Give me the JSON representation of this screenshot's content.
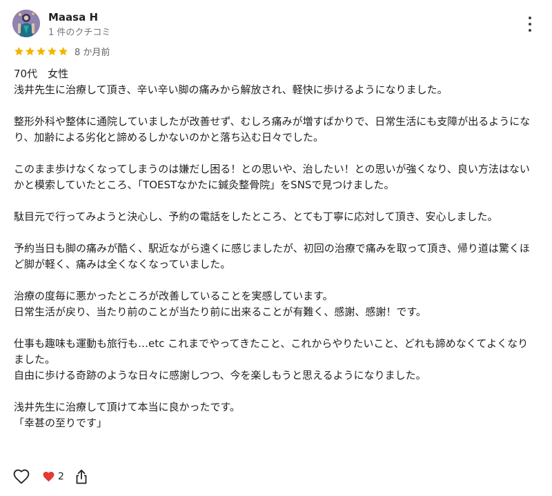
{
  "reviewer": {
    "name": "Maasa H",
    "review_count": "1 件のクチコミ",
    "avatar_icon": "avatar-illustration"
  },
  "rating": {
    "stars": 5,
    "max": 5,
    "star_color": "#f4b400",
    "date": "8 か月前"
  },
  "review": {
    "paragraphs": [
      "70代　女性\n浅井先生に治療して頂き、辛い辛い脚の痛みから解放され、軽快に歩けるようになりました。",
      "整形外科や整体に通院していましたが改善せず、むしろ痛みが増すばかりで、日常生活にも支障が出るようになり、加齢による劣化と諦めるしかないのかと落ち込む日々でした。",
      "このまま歩けなくなってしまうのは嫌だし困る！との思いや、治したい！との思いが強くなり、良い方法はないかと模索していたところ、「TOESTなかたに鍼灸整骨院」をSNSで見つけました。",
      "駄目元で行ってみようと決心し、予約の電話をしたところ、とても丁寧に応対して頂き、安心しました。",
      "予約当日も脚の痛みが酷く、駅近ながら遠くに感じましたが、初回の治療で痛みを取って頂き、帰り道は驚くほど脚が軽く、痛みは全くなくなっていました。",
      "治療の度毎に悪かったところが改善していることを実感しています。\n日常生活が戻り、当たり前のことが当たり前に出来ることが有難く、感謝、感謝！です。",
      "仕事も趣味も運動も旅行も…etc これまでやってきたこと、これからやりたいこと、どれも諦めなくてよくなりました。\n自由に歩ける奇跡のような日々に感謝しつつ、今を楽しもうと思えるようになりました。",
      "浅井先生に治療して頂けて本当に良かったです。\n「幸甚の至りです」"
    ]
  },
  "actions": {
    "like_icon": "heart-outline-icon",
    "reaction_icon": "red-heart-icon",
    "reaction_count": "2",
    "share_icon": "share-icon",
    "more_icon": "more-vertical-icon",
    "reaction_color": "#e53935"
  }
}
